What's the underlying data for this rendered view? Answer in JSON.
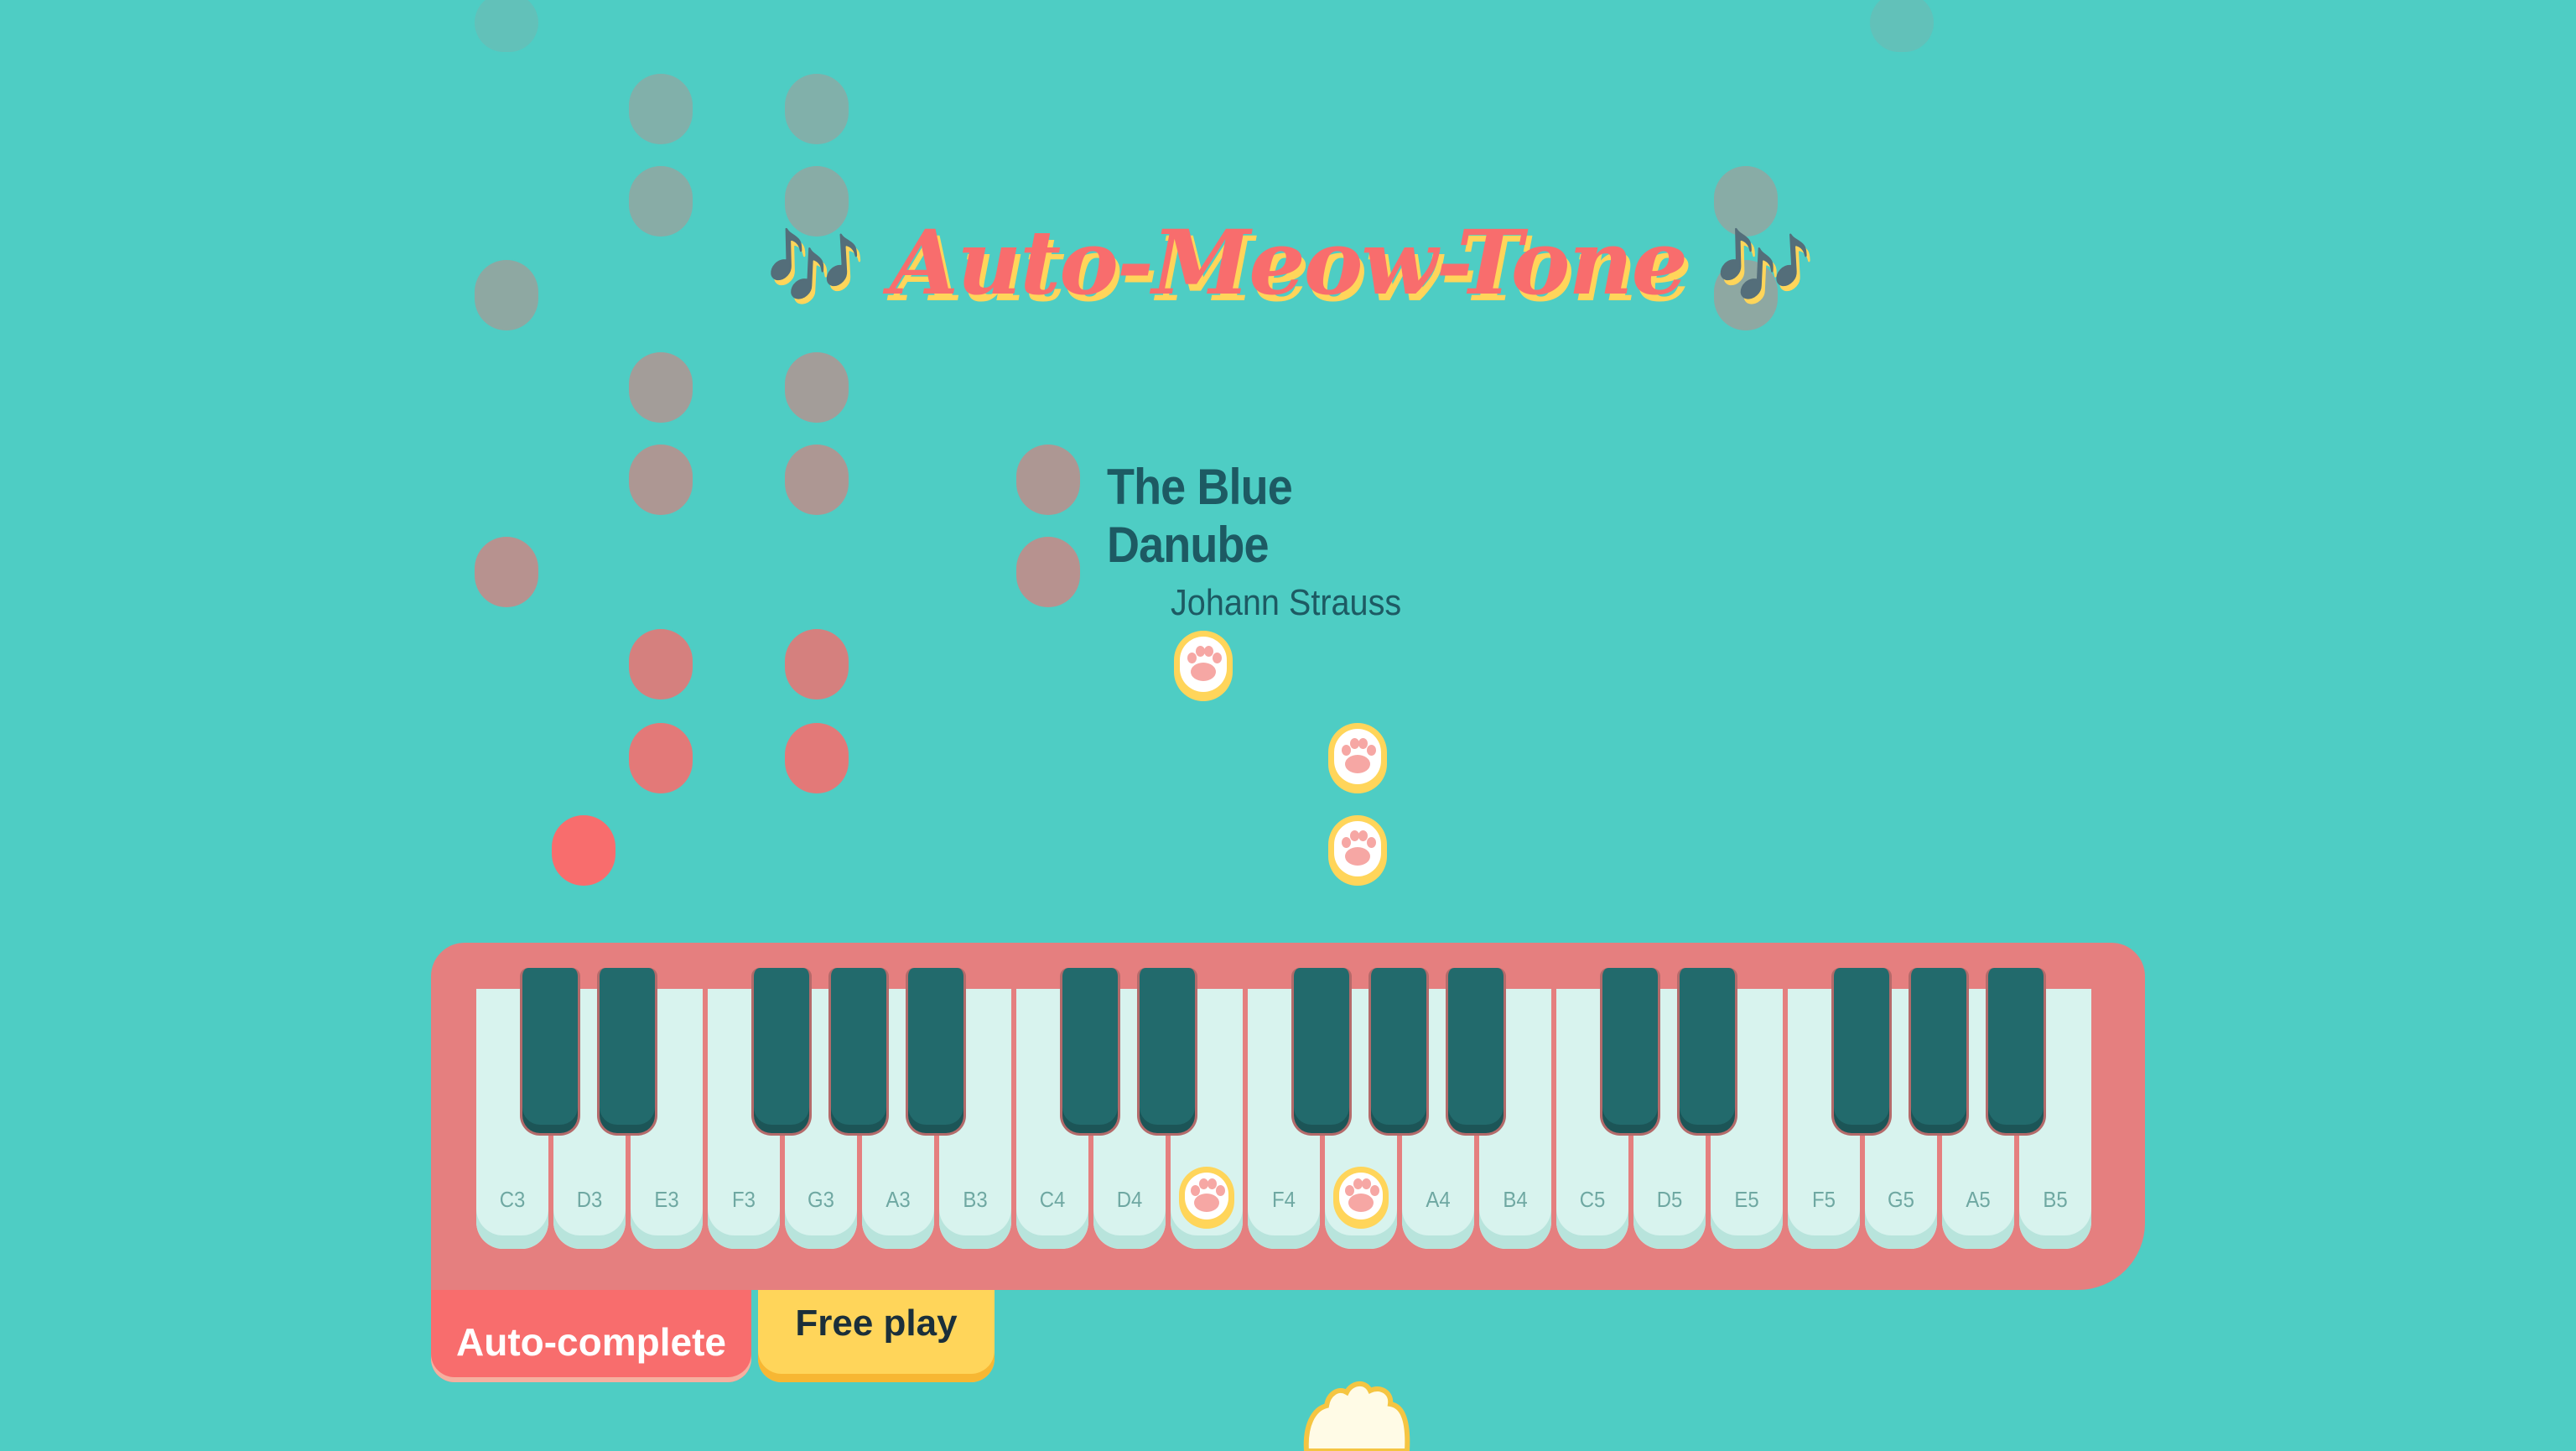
{
  "app": {
    "title": "Auto-Meow-Tone",
    "title_decoration": "🎶"
  },
  "song": {
    "title": "The Blue Danube",
    "composer": "Johann Strauss"
  },
  "piano": {
    "keys": [
      "C3",
      "D3",
      "E3",
      "F3",
      "G3",
      "A3",
      "B3",
      "C4",
      "D4",
      "E4",
      "F4",
      "G4",
      "A4",
      "B4",
      "C5",
      "D5",
      "E5",
      "F5",
      "G5",
      "A5",
      "B5"
    ],
    "highlighted_keys": [
      "E4",
      "G4"
    ]
  },
  "modes": {
    "auto_complete": "Auto-complete",
    "free_play": "Free play",
    "active": "Auto-complete"
  },
  "colors": {
    "background": "#4ecdc4",
    "accent_coral": "#f86d6d",
    "accent_yellow": "#ffd55a",
    "black_key": "#226a6c",
    "white_key": "#d8f3ee"
  },
  "icons": {
    "note": "paw-icon",
    "cursor": "cat-paw-cursor-icon"
  }
}
